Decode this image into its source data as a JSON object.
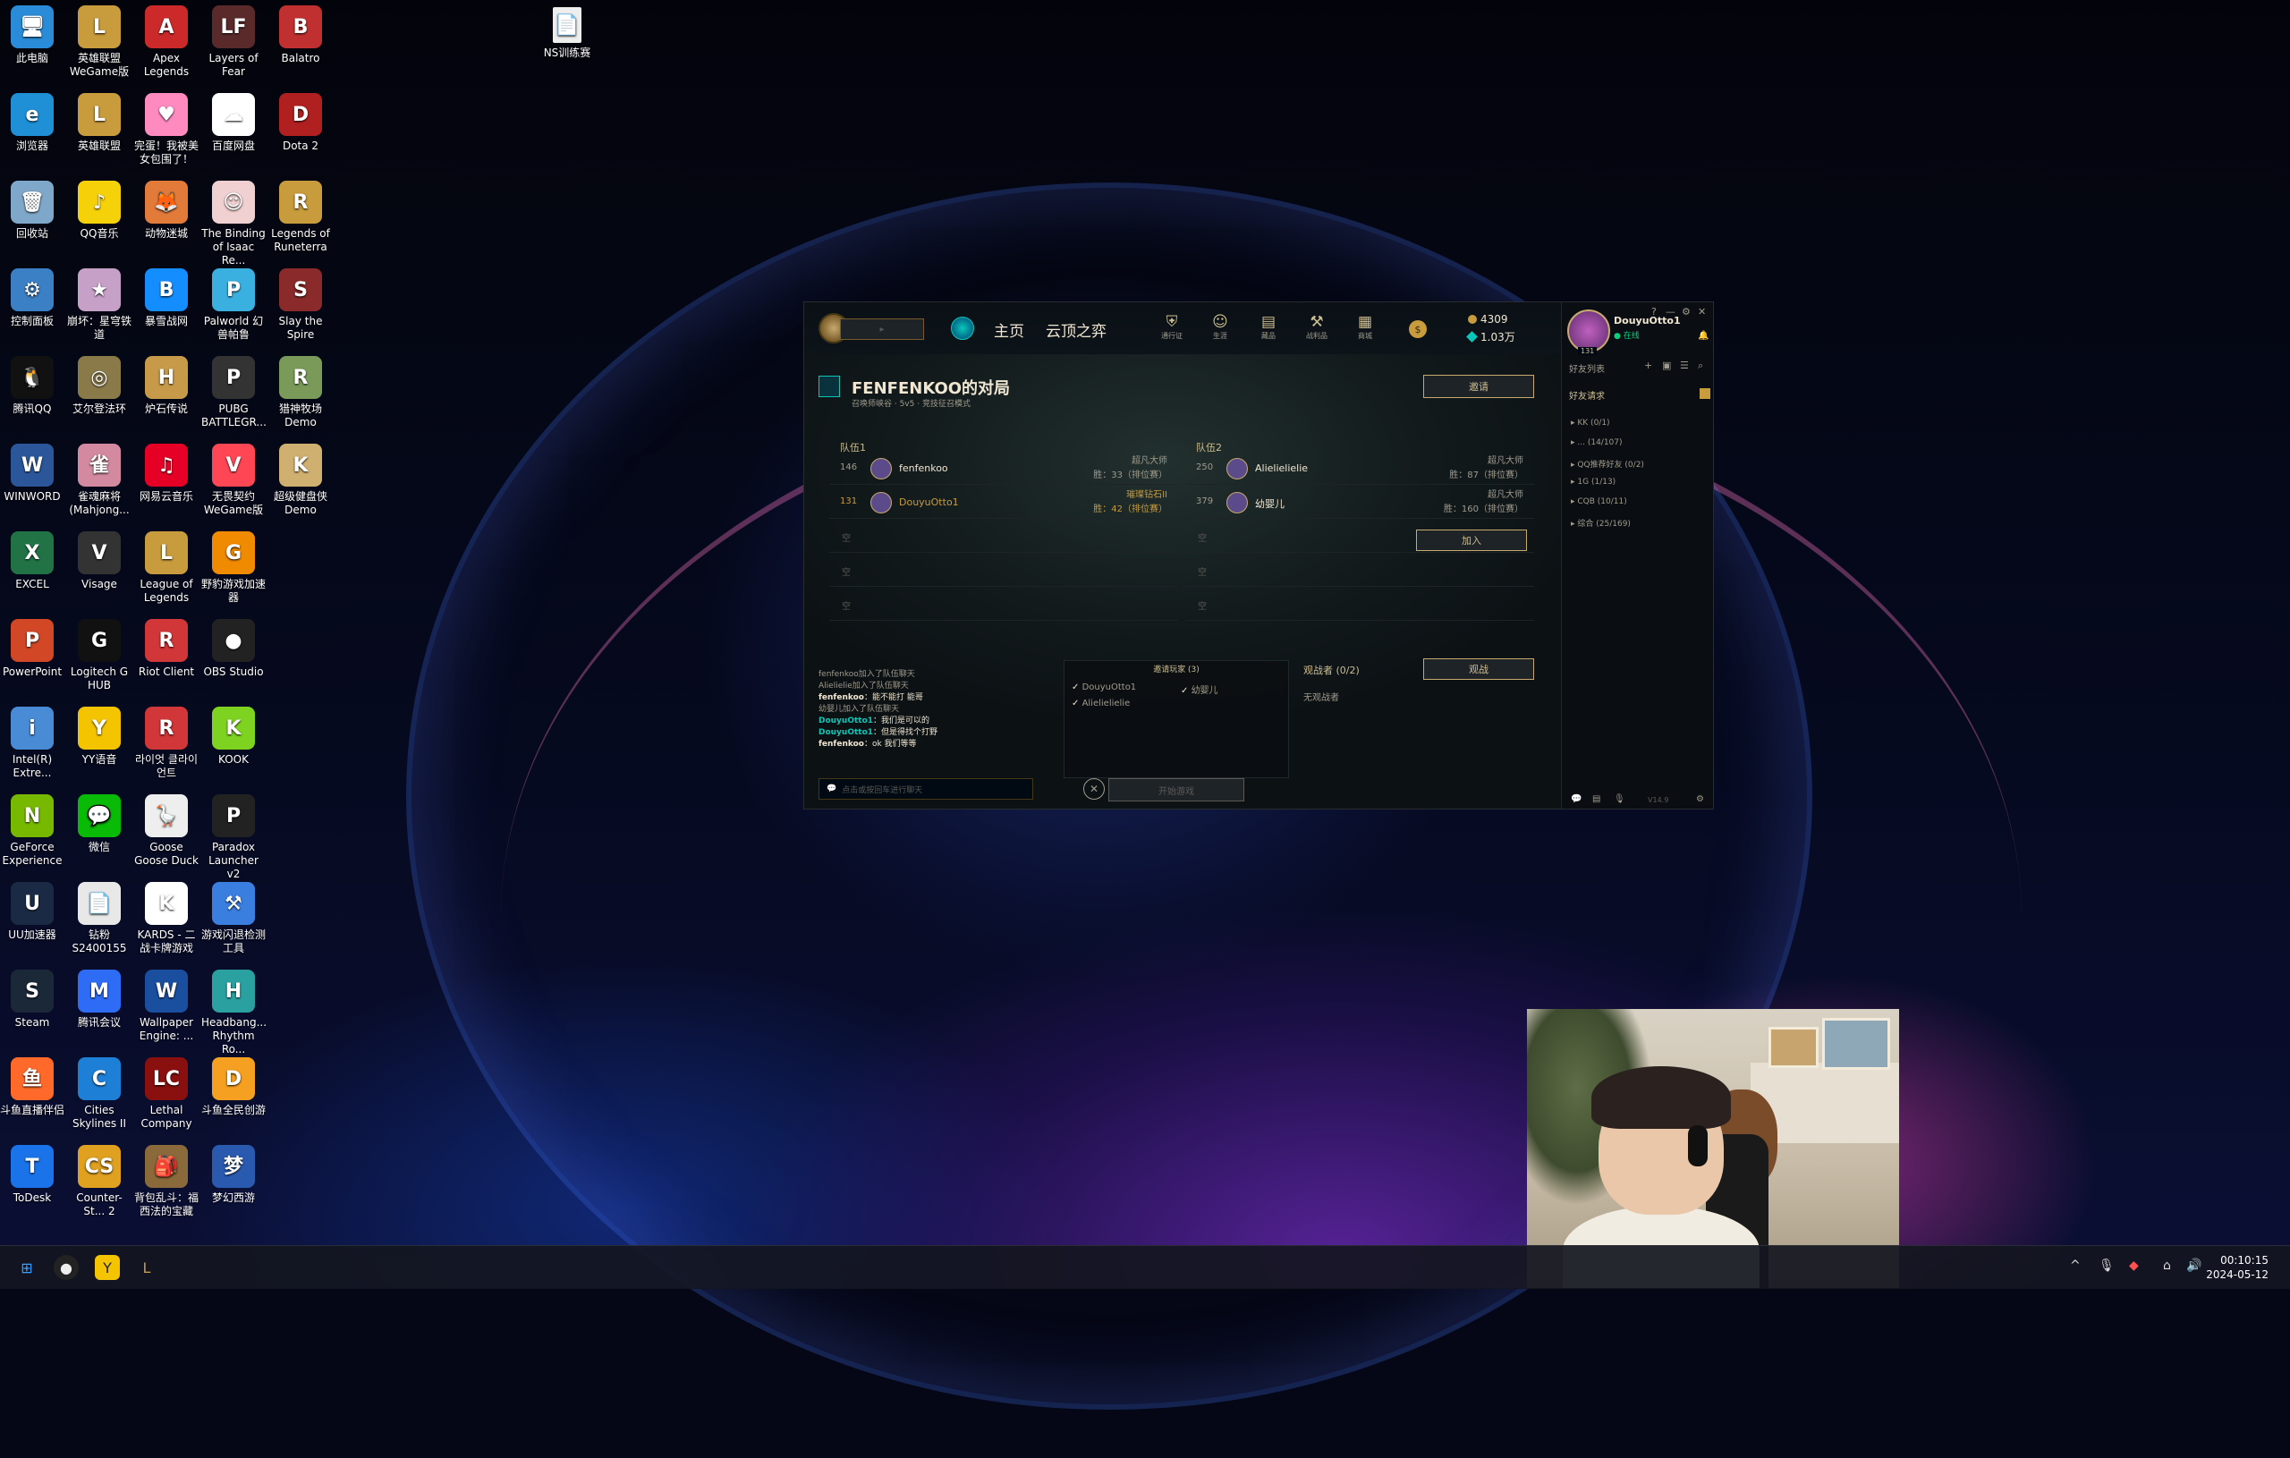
{
  "desktop_icons": [
    {
      "label": "此电脑",
      "icon": "monitor-icon",
      "color": "#2a8cd8",
      "glyph": "🖥"
    },
    {
      "label": "浏览器",
      "icon": "edge-icon",
      "color": "#1f8fd6",
      "glyph": "e"
    },
    {
      "label": "回收站",
      "icon": "recycle-bin-icon",
      "color": "#7fa7c9",
      "glyph": "🗑"
    },
    {
      "label": "控制面板",
      "icon": "control-panel-icon",
      "color": "#3b7fc4",
      "glyph": "⚙"
    },
    {
      "label": "腾讯QQ",
      "icon": "qq-icon",
      "color": "#111111",
      "glyph": "🐧"
    },
    {
      "label": "WINWORD",
      "icon": "word-icon",
      "color": "#2b579a",
      "glyph": "W"
    },
    {
      "label": "EXCEL",
      "icon": "excel-icon",
      "color": "#217346",
      "glyph": "X"
    },
    {
      "label": "PowerPoint",
      "icon": "powerpoint-icon",
      "color": "#d24726",
      "glyph": "P"
    },
    {
      "label": "Intel(R) Extre...",
      "icon": "intel-icon",
      "color": "#4a8bd6",
      "glyph": "i"
    },
    {
      "label": "GeForce Experience",
      "icon": "nvidia-icon",
      "color": "#76b900",
      "glyph": "N"
    },
    {
      "label": "UU加速器",
      "icon": "uu-icon",
      "color": "#1b2a44",
      "glyph": "U"
    },
    {
      "label": "Steam",
      "icon": "steam-icon",
      "color": "#1b2838",
      "glyph": "S"
    },
    {
      "label": "斗鱼直播伴侣",
      "icon": "douyu-icon",
      "color": "#ff6a2a",
      "glyph": "鱼"
    },
    {
      "label": "ToDesk",
      "icon": "todesk-icon",
      "color": "#1a73e8",
      "glyph": "T"
    },
    {
      "label": "英雄联盟WeGame版",
      "icon": "lol-wegame-icon",
      "color": "#c89b3c",
      "glyph": "L"
    },
    {
      "label": "英雄联盟",
      "icon": "lol-icon",
      "color": "#c89b3c",
      "glyph": "L"
    },
    {
      "label": "QQ音乐",
      "icon": "qq-music-icon",
      "color": "#f5d10a",
      "glyph": "♪"
    },
    {
      "label": "崩坏：星穹铁道",
      "icon": "star-rail-icon",
      "color": "#c7a0c8",
      "glyph": "★"
    },
    {
      "label": "艾尔登法环",
      "icon": "elden-ring-icon",
      "color": "#8a7a4a",
      "glyph": "◎"
    },
    {
      "label": "雀魂麻将(Mahjong...",
      "icon": "mahjong-soul-icon",
      "color": "#d38aa0",
      "glyph": "雀"
    },
    {
      "label": "Visage",
      "icon": "visage-icon",
      "color": "#333333",
      "glyph": "V"
    },
    {
      "label": "Logitech G HUB",
      "icon": "logitech-icon",
      "color": "#111111",
      "glyph": "G"
    },
    {
      "label": "YY语音",
      "icon": "yy-icon",
      "color": "#f5c400",
      "glyph": "Y"
    },
    {
      "label": "微信",
      "icon": "wechat-icon",
      "color": "#09bb07",
      "glyph": "💬"
    },
    {
      "label": "钻粉S2400155",
      "icon": "document-icon",
      "color": "#e8e8e8",
      "glyph": "📄"
    },
    {
      "label": "腾讯会议",
      "icon": "tencent-meeting-icon",
      "color": "#2f6cf6",
      "glyph": "M"
    },
    {
      "label": "Cities Skylines II",
      "icon": "cities-icon",
      "color": "#1e7fd6",
      "glyph": "C"
    },
    {
      "label": "Counter-St... 2",
      "icon": "cs2-icon",
      "color": "#e0a020",
      "glyph": "CS"
    },
    {
      "label": "Apex Legends",
      "icon": "apex-icon",
      "color": "#cc2a2a",
      "glyph": "A"
    },
    {
      "label": "完蛋！我被美女包围了！",
      "icon": "heart-game-icon",
      "color": "#ff8ac0",
      "glyph": "♥"
    },
    {
      "label": "动物迷城",
      "icon": "animal-game-icon",
      "color": "#e27a3a",
      "glyph": "🦊"
    },
    {
      "label": "暴雪战网",
      "icon": "battlenet-icon",
      "color": "#148eff",
      "glyph": "B"
    },
    {
      "label": "炉石传说",
      "icon": "hearthstone-icon",
      "color": "#c79a4a",
      "glyph": "H"
    },
    {
      "label": "网易云音乐",
      "icon": "netease-music-icon",
      "color": "#e60026",
      "glyph": "♫"
    },
    {
      "label": "League of Legends",
      "icon": "lol-en-icon",
      "color": "#c89b3c",
      "glyph": "L"
    },
    {
      "label": "Riot Client",
      "icon": "riot-icon",
      "color": "#d13639",
      "glyph": "R"
    },
    {
      "label": "라이엇 클라이언트",
      "icon": "riot-kr-icon",
      "color": "#d13639",
      "glyph": "R"
    },
    {
      "label": "Goose Goose Duck",
      "icon": "goose-icon",
      "color": "#eeeeee",
      "glyph": "🪿"
    },
    {
      "label": "KARDS - 二战卡牌游戏",
      "icon": "kards-icon",
      "color": "#ffffff",
      "glyph": "K"
    },
    {
      "label": "Wallpaper Engine: ...",
      "icon": "wallpaper-engine-icon",
      "color": "#1a4fa0",
      "glyph": "W"
    },
    {
      "label": "Lethal Company",
      "icon": "lethal-company-icon",
      "color": "#8a1010",
      "glyph": "LC"
    },
    {
      "label": "背包乱斗：福西法的宝藏",
      "icon": "backpack-icon",
      "color": "#8a6a3a",
      "glyph": "🎒"
    },
    {
      "label": "Layers of Fear",
      "icon": "layers-of-fear-icon",
      "color": "#5a2a2a",
      "glyph": "LF"
    },
    {
      "label": "百度网盘",
      "icon": "baidu-pan-icon",
      "color": "#ffffff",
      "glyph": "☁"
    },
    {
      "label": "The Binding of Isaac Re...",
      "icon": "isaac-icon",
      "color": "#f0d0d0",
      "glyph": "☺"
    },
    {
      "label": "Palworld 幻兽帕鲁",
      "icon": "palworld-icon",
      "color": "#3ab0e0",
      "glyph": "P"
    },
    {
      "label": "PUBG BATTLEGR...",
      "icon": "pubg-icon",
      "color": "#333333",
      "glyph": "P"
    },
    {
      "label": "无畏契约WeGame版",
      "icon": "valorant-icon",
      "color": "#ff4655",
      "glyph": "V"
    },
    {
      "label": "野豹游戏加速器",
      "icon": "accelerator-icon",
      "color": "#f08a00",
      "glyph": "G"
    },
    {
      "label": "OBS Studio",
      "icon": "obs-icon",
      "color": "#222222",
      "glyph": "●"
    },
    {
      "label": "KOOK",
      "icon": "kook-icon",
      "color": "#7ed321",
      "glyph": "K"
    },
    {
      "label": "Paradox Launcher v2",
      "icon": "paradox-icon",
      "color": "#222222",
      "glyph": "P"
    },
    {
      "label": "游戏闪退检测工具",
      "icon": "crash-tool-icon",
      "color": "#3a7fe0",
      "glyph": "⚒"
    },
    {
      "label": "Headbang... Rhythm Ro...",
      "icon": "headbang-icon",
      "color": "#2aa0a0",
      "glyph": "H"
    },
    {
      "label": "斗鱼全民创游",
      "icon": "douyu-game-icon",
      "color": "#f5a020",
      "glyph": "D"
    },
    {
      "label": "梦幻西游",
      "icon": "mhxy-icon",
      "color": "#2a5ab0",
      "glyph": "梦"
    },
    {
      "label": "Balatro",
      "icon": "balatro-icon",
      "color": "#c03030",
      "glyph": "B"
    },
    {
      "label": "Dota 2",
      "icon": "dota2-icon",
      "color": "#b02020",
      "glyph": "D"
    },
    {
      "label": "Legends of Runeterra",
      "icon": "runeterra-icon",
      "color": "#c89b3c",
      "glyph": "R"
    },
    {
      "label": "Slay the Spire",
      "icon": "slay-spire-icon",
      "color": "#8a2a2a",
      "glyph": "S"
    },
    {
      "label": "猎神牧场 Demo",
      "icon": "ranch-demo-icon",
      "color": "#7a9a5a",
      "glyph": "R"
    },
    {
      "label": "超级健盘侠 Demo",
      "icon": "keyboard-demo-icon",
      "color": "#d0b070",
      "glyph": "K"
    }
  ],
  "desktop_file": {
    "label": "NS训练赛",
    "icon": "document-icon"
  },
  "client": {
    "nav": {
      "home": "主页",
      "tft": "云顶之弈"
    },
    "header_icons": [
      {
        "label": "通行证",
        "icon": "pass-icon"
      },
      {
        "label": "生涯",
        "icon": "profile-icon"
      },
      {
        "label": "藏品",
        "icon": "collection-icon"
      },
      {
        "label": "战利品",
        "icon": "loot-icon"
      },
      {
        "label": "商城",
        "icon": "store-icon"
      }
    ],
    "currency": {
      "rp": "4309",
      "be": "1.03万"
    },
    "lobby": {
      "title": "FENFENKOO的对局",
      "subtitle": "召唤师峡谷 · 5v5 · 竞技征召模式",
      "invite_button": "邀请",
      "join_button": "加入",
      "spectate_button": "观战",
      "team1_label": "队伍1",
      "team2_label": "队伍2",
      "empty_label": "空",
      "team1": [
        {
          "level": "146",
          "name": "fenfenkoo",
          "rank": "超凡大师",
          "wins": "胜：33（排位赛）"
        },
        {
          "level": "131",
          "name": "DouyuOtto1",
          "rank": "璀璨钻石II",
          "wins": "胜：42（排位赛）"
        }
      ],
      "team2": [
        {
          "level": "250",
          "name": "Alielielielie",
          "rank": "超凡大师",
          "wins": "胜：87（排位赛）"
        },
        {
          "level": "379",
          "name": "幼婴儿",
          "rank": "超凡大师",
          "wins": "胜：160（排位赛）"
        }
      ],
      "invited_title": "邀请玩家 (3)",
      "invited": [
        "DouyuOtto1",
        "幼婴儿",
        "Alielielielie"
      ],
      "spectators_title": "观战者 (0/2)",
      "no_spectators": "无观战者",
      "start_button": "开始游戏",
      "chat_lines": [
        {
          "speaker": "",
          "text": "fenfenkoo加入了队伍聊天"
        },
        {
          "speaker": "",
          "text": "Alielielie加入了队伍聊天"
        },
        {
          "speaker": "fenfenkoo",
          "text": "：能不能打 能哥"
        },
        {
          "speaker": "",
          "text": "幼婴儿加入了队伍聊天"
        },
        {
          "speaker": "DouyuOtto1",
          "text": "：我们是可以的"
        },
        {
          "speaker": "DouyuOtto1",
          "text": "：但是得找个打野"
        },
        {
          "speaker": "fenfenkoo",
          "text": "：ok 我们等等"
        }
      ],
      "chat_placeholder": "点击或按回车进行聊天"
    },
    "social": {
      "username": "DouyuOtto1",
      "status": "在线",
      "level": "131",
      "friends_label": "好友列表",
      "requests_label": "好友请求",
      "groups": [
        "KK (0/1)",
        "... (14/107)",
        "QQ推荐好友 (0/2)",
        "1G (1/13)",
        "CQB (10/11)",
        "综合 (25/169)"
      ],
      "version": "V14.9"
    }
  },
  "taskbar": {
    "time": "00:10:15",
    "date": "2024-05-12"
  }
}
